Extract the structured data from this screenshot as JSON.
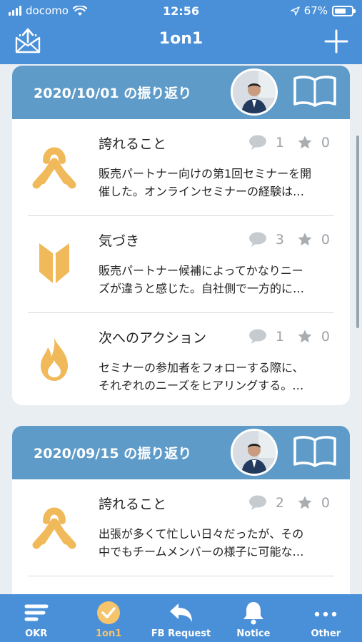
{
  "status_bar": {
    "carrier": "docomo",
    "time": "12:56",
    "battery_percent": "67%",
    "battery_level": 0.67
  },
  "header": {
    "title": "1on1",
    "left_icon": "inbox-upload-icon",
    "right_icon": "plus-icon"
  },
  "reviews": [
    {
      "title": "2020/10/01 の振り返り",
      "entries": [
        {
          "icon": "ribbon-icon",
          "title": "誇れること",
          "comments": "1",
          "stars": "0",
          "body_line1": "販売パートナー向けの第1回セミナーを開",
          "body_line2": "催した。オンラインセミナーの経験は…"
        },
        {
          "icon": "beginner-mark-icon",
          "title": "気づき",
          "comments": "3",
          "stars": "0",
          "body_line1": "販売パートナー候補によってかなりニー",
          "body_line2": "ズが違うと感じた。自社側で一方的に…"
        },
        {
          "icon": "flame-icon",
          "title": "次へのアクション",
          "comments": "1",
          "stars": "0",
          "body_line1": "セミナーの参加者をフォローする際に、",
          "body_line2": "それぞれのニーズをヒアリングする。…"
        }
      ]
    },
    {
      "title": "2020/09/15 の振り返り",
      "entries": [
        {
          "icon": "ribbon-icon",
          "title": "誇れること",
          "comments": "2",
          "stars": "0",
          "body_line1": "出張が多くて忙しい日々だったが、その",
          "body_line2": "中でもチームメンバーの様子に可能な…"
        }
      ]
    }
  ],
  "tabs": [
    {
      "label": "OKR",
      "icon": "okr-lines-icon",
      "active": false
    },
    {
      "label": "1on1",
      "icon": "check-circle-icon",
      "active": true
    },
    {
      "label": "FB Request",
      "icon": "reply-arrow-icon",
      "active": false
    },
    {
      "label": "Notice",
      "icon": "bell-icon",
      "active": false
    },
    {
      "label": "Other",
      "icon": "more-dots-icon",
      "active": false
    }
  ],
  "colors": {
    "brand_blue": "#4a90d9",
    "card_header": "#5f9bc9",
    "accent_yellow": "#f0b95a",
    "active_tab": "#f5c46b"
  }
}
